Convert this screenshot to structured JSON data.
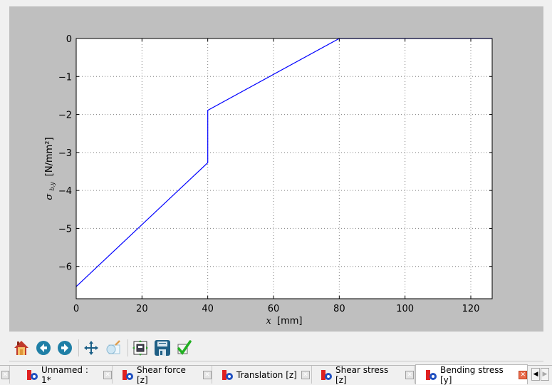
{
  "chart_data": {
    "type": "line",
    "title": "",
    "xlabel_var": "x",
    "xlabel_unit": "[mm]",
    "ylabel_var": "σ",
    "ylabel_sub": "b,y",
    "ylabel_unit": "[N/mm²]",
    "xlim": [
      0,
      126.5
    ],
    "ylim": [
      -6.85,
      0
    ],
    "grid": true,
    "xticks": [
      0,
      20,
      40,
      60,
      80,
      100,
      120
    ],
    "xtick_labels": [
      "0",
      "20",
      "40",
      "60",
      "80",
      "100",
      "120"
    ],
    "yticks": [
      0,
      -1,
      -2,
      -3,
      -4,
      -5,
      -6
    ],
    "ytick_labels": [
      "0",
      "−1",
      "−2",
      "−3",
      "−4",
      "−5",
      "−6"
    ],
    "series": [
      {
        "name": "Bending stress [y]",
        "color": "#0000ff",
        "x": [
          0,
          40,
          40,
          80,
          126.5
        ],
        "y": [
          -6.53,
          -3.27,
          -1.89,
          0,
          0
        ]
      }
    ]
  },
  "toolbar": {
    "buttons": [
      {
        "name": "home-button",
        "icon": "home-icon",
        "tooltip": "Home"
      },
      {
        "name": "back-button",
        "icon": "arrow-left-icon",
        "tooltip": "Back"
      },
      {
        "name": "forward-button",
        "icon": "arrow-right-icon",
        "tooltip": "Forward"
      },
      {
        "name": "pan-button",
        "icon": "move-icon",
        "tooltip": "Pan"
      },
      {
        "name": "zoom-button",
        "icon": "zoom-rect-icon",
        "tooltip": "Zoom"
      },
      {
        "name": "subplots-button",
        "icon": "subplots-icon",
        "tooltip": "Configure subplots"
      },
      {
        "name": "save-button",
        "icon": "floppy-icon",
        "tooltip": "Save"
      },
      {
        "name": "edit-button",
        "icon": "checkmark-icon",
        "tooltip": "Edit"
      }
    ]
  },
  "tabs": [
    {
      "label": "Unnamed : 1*",
      "active": false
    },
    {
      "label": "Shear force [z]",
      "active": false
    },
    {
      "label": "Translation [z]",
      "active": false
    },
    {
      "label": "Shear stress [z]",
      "active": false
    },
    {
      "label": "Bending stress [y]",
      "active": true
    }
  ],
  "tab_scroll": {
    "left": "◀",
    "right": "▶"
  },
  "colors": {
    "figure_bg": "#bfbfbf",
    "axes_bg": "#ffffff",
    "line": "#0000ff",
    "grid": "#808080"
  }
}
